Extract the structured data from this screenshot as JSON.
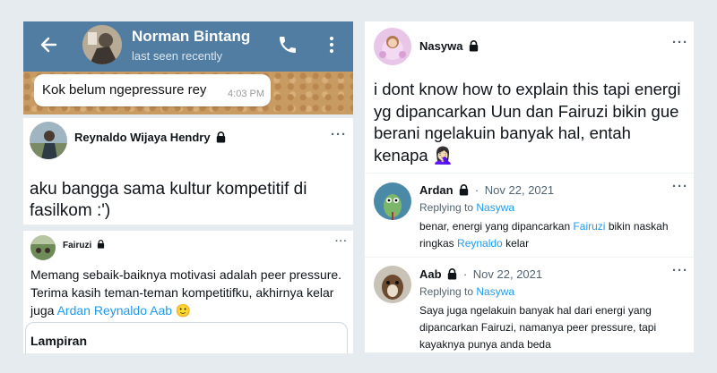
{
  "chat": {
    "contact_name": "Norman Bintang",
    "status": "last seen recently",
    "message_text": "Kok belum ngepressure rey",
    "message_time": "4:03 PM",
    "colors": {
      "header": "#517da2",
      "wallpaper": "#c79a62"
    }
  },
  "tweet1": {
    "author": "Reynaldo Wijaya Hendry",
    "text": "aku bangga sama kultur kompetitif di fasilkom :')"
  },
  "tweet2": {
    "author": "Fairuzi",
    "text_part1": "Memang sebaik-baiknya motivasi adalah peer pressure. Terima kasih teman-teman kompetitifku, akhirnya kelar juga ",
    "mentions": "Ardan Reynaldo Aab",
    "emoji": "🙂",
    "attachment_label": "Lampiran"
  },
  "thread": {
    "author": "Nasywa",
    "text": "i dont know how to explain this tapi energi yg dipancarkan Uun dan Fairuzi bikin gue berani ngelakuin banyak hal, entah kenapa",
    "emoji": "🤦🏻‍♀️",
    "replies": [
      {
        "author": "Ardan",
        "date": "Nov 22, 2021",
        "replying_to_label": "Replying to",
        "replying_to": "Nasywa",
        "text_a": "benar, energi yang dipancarkan ",
        "link_a": "Fairuzi",
        "text_b": " bikin naskah ringkas ",
        "link_b": "Reynaldo",
        "text_c": " kelar"
      },
      {
        "author": "Aab",
        "date": "Nov 22, 2021",
        "replying_to_label": "Replying to",
        "replying_to": "Nasywa",
        "text": "Saya juga ngelakuin banyak hal dari energi yang dipancarkan Fairuzi, namanya peer pressure, tapi kayaknya punya anda beda"
      }
    ]
  },
  "ui": {
    "dots": "···",
    "dot_separator": "·",
    "accent": "#1d9bf0"
  }
}
